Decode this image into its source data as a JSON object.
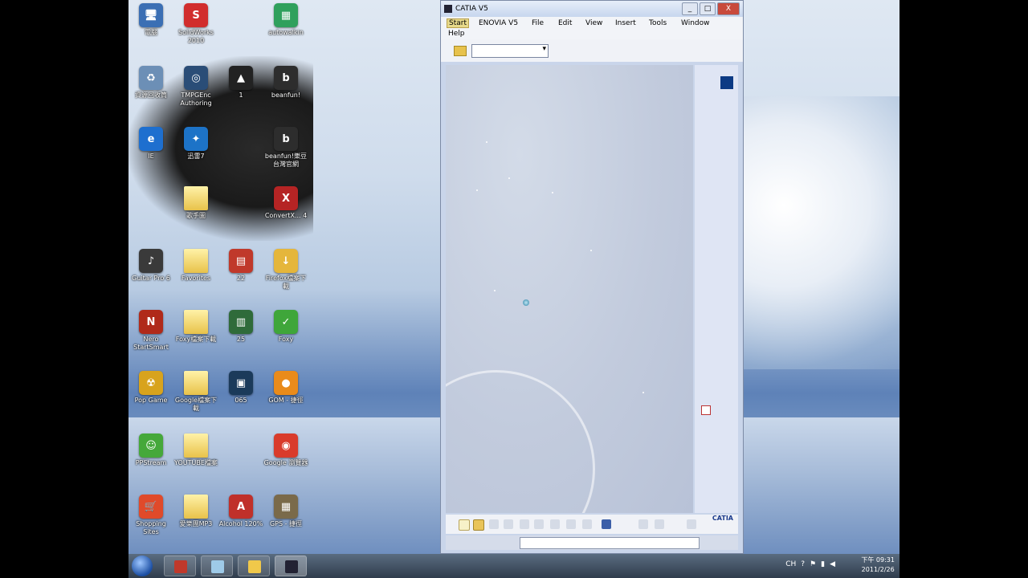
{
  "desktop": {
    "icons": [
      {
        "name": "desktop-icon-computer",
        "label": "電腦",
        "glyph": "🖥",
        "bg": "#3b6fb4"
      },
      {
        "name": "desktop-icon-solidworks",
        "label": "SolidWorks 2010",
        "glyph": "S",
        "bg": "#d12d2d"
      },
      {
        "name": "desktop-icon-autocad",
        "label": "autowalkin",
        "glyph": "▦",
        "bg": "#2fa05c"
      },
      {
        "name": "desktop-icon-recycle",
        "label": "資源回收筒",
        "glyph": "♻",
        "bg": "#6c8fb6"
      },
      {
        "name": "desktop-icon-tmpgenc",
        "label": "TMPGEnc Authoring",
        "glyph": "◎",
        "bg": "#2a4d77"
      },
      {
        "name": "desktop-icon-1",
        "label": "1",
        "glyph": "▲",
        "bg": "#222222"
      },
      {
        "name": "desktop-icon-beanfun",
        "label": "beanfun!",
        "glyph": "b",
        "bg": "#2d2d2d"
      },
      {
        "name": "desktop-icon-ie",
        "label": "IE",
        "glyph": "e",
        "bg": "#1e6fcf"
      },
      {
        "name": "desktop-icon-xunlei",
        "label": "迅雷7",
        "glyph": "✦",
        "bg": "#1d73c7"
      },
      {
        "name": "desktop-icon-beanfun2",
        "label": "beanfun!樂豆台灣官網",
        "glyph": "b",
        "bg": "#2d2d2d"
      },
      {
        "name": "desktop-icon-folder1",
        "label": "歌手圖",
        "glyph": "",
        "bg": ""
      },
      {
        "name": "desktop-icon-convertx",
        "label": "ConvertX... 4",
        "glyph": "X",
        "bg": "#b52424"
      },
      {
        "name": "desktop-icon-guitarpro",
        "label": "Guitar Pro 6",
        "glyph": "♪",
        "bg": "#3a3a3a"
      },
      {
        "name": "desktop-icon-favorites",
        "label": "Favorites",
        "glyph": "",
        "bg": ""
      },
      {
        "name": "desktop-icon-22",
        "label": "22",
        "glyph": "▤",
        "bg": "#c0392b"
      },
      {
        "name": "desktop-icon-firefox-dl",
        "label": "Firefox檔案下載",
        "glyph": "↓",
        "bg": "#e5b63b"
      },
      {
        "name": "desktop-icon-nero",
        "label": "Nero StartSmart",
        "glyph": "N",
        "bg": "#b02a1a"
      },
      {
        "name": "desktop-icon-foxy-dl",
        "label": "Foxy檔案下載",
        "glyph": "",
        "bg": ""
      },
      {
        "name": "desktop-icon-25",
        "label": "25",
        "glyph": "▥",
        "bg": "#2f6b3a"
      },
      {
        "name": "desktop-icon-foxy",
        "label": "Foxy",
        "glyph": "✓",
        "bg": "#3fa63a"
      },
      {
        "name": "desktop-icon-popgame",
        "label": "Pop Game",
        "glyph": "☢",
        "bg": "#d8a31d"
      },
      {
        "name": "desktop-icon-google-dl",
        "label": "Google檔案下載",
        "glyph": "",
        "bg": ""
      },
      {
        "name": "desktop-icon-065",
        "label": "065",
        "glyph": "▣",
        "bg": "#1b3a5a"
      },
      {
        "name": "desktop-icon-gom",
        "label": "GOM - 捷徑",
        "glyph": "●",
        "bg": "#e98b1b"
      },
      {
        "name": "desktop-icon-ppstream",
        "label": "PPStream",
        "glyph": "☺",
        "bg": "#45a83a"
      },
      {
        "name": "desktop-icon-youtube-dl",
        "label": "YOUTUBE檔案",
        "glyph": "",
        "bg": ""
      },
      {
        "name": "desktop-icon-chrome",
        "label": "Google 瀏覽器",
        "glyph": "◉",
        "bg": "#d93b2b"
      },
      {
        "name": "desktop-icon-shopping",
        "label": "Shopping Sites",
        "glyph": "🛒",
        "bg": "#e04a2a"
      },
      {
        "name": "desktop-icon-mp3",
        "label": "愛樂團MP3",
        "glyph": "",
        "bg": ""
      },
      {
        "name": "desktop-icon-alcohol",
        "label": "Alcohol 120%",
        "glyph": "A",
        "bg": "#c0302a"
      },
      {
        "name": "desktop-icon-gps",
        "label": "GPS - 捷徑",
        "glyph": "▦",
        "bg": "#7a6a4a"
      }
    ]
  },
  "window": {
    "title": "CATIA V5",
    "minimize": "_",
    "maximize": "□",
    "close": "X",
    "menu": {
      "start": "Start",
      "enovia": "ENOVIA V5",
      "file": "File",
      "edit": "Edit",
      "view": "View",
      "insert": "Insert",
      "tools": "Tools",
      "window": "Window",
      "help": "Help"
    },
    "combo_value": "",
    "brand": "CATIA"
  },
  "taskbar": {
    "time": "下午 09:31",
    "date": "2011/2/26",
    "ime": "CH"
  }
}
